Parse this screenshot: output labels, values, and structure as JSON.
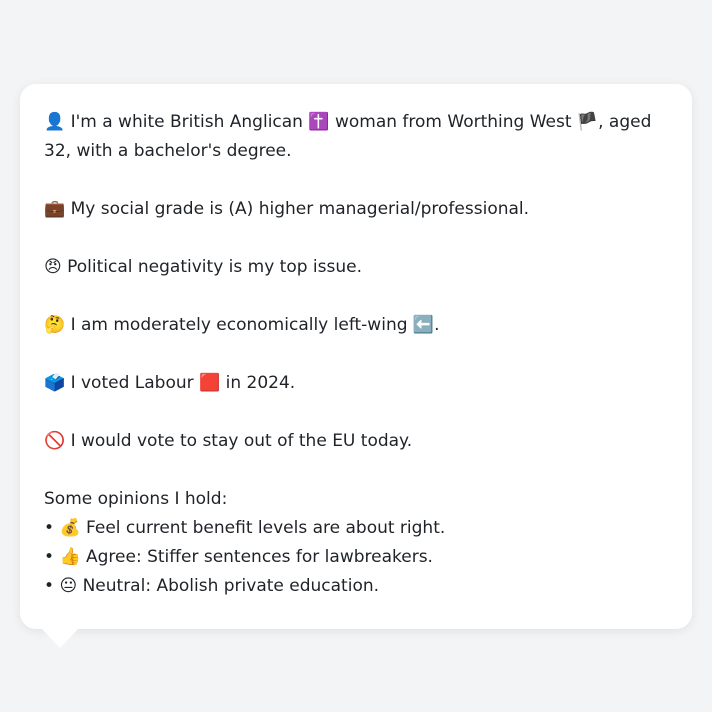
{
  "bubble": {
    "identity": {
      "icon": "👤",
      "text_a": " I'm a white British Anglican ",
      "religion_icon": "✝️",
      "text_b": " woman from Worthing West ",
      "flag_icon": "🏴",
      "text_c": ", aged 32, with a bachelor's degree."
    },
    "social_grade": {
      "icon": "💼",
      "text": " My social grade is (A) higher managerial/professional."
    },
    "top_issue": {
      "icon": "😠",
      "text": " Political negativity is my top issue."
    },
    "economics": {
      "icon": "🤔",
      "text_a": " I am moderately economically left-wing ",
      "arrow_icon": "⬅️",
      "text_b": "."
    },
    "vote_2024": {
      "icon": "🗳️",
      "text_a": " I voted Labour ",
      "party_icon": "🟥",
      "text_b": " in 2024."
    },
    "eu": {
      "icon": "🚫",
      "text": " I would vote to stay out of the EU today."
    },
    "opinions": {
      "heading": "Some opinions I hold:",
      "items": [
        {
          "bullet": "• ",
          "icon": "💰",
          "text": " Feel current benefit levels are about right."
        },
        {
          "bullet": "• ",
          "icon": "👍",
          "text": " Agree: Stiffer sentences for lawbreakers."
        },
        {
          "bullet": "• ",
          "icon": "😐",
          "text": " Neutral: Abolish private education."
        }
      ]
    }
  }
}
